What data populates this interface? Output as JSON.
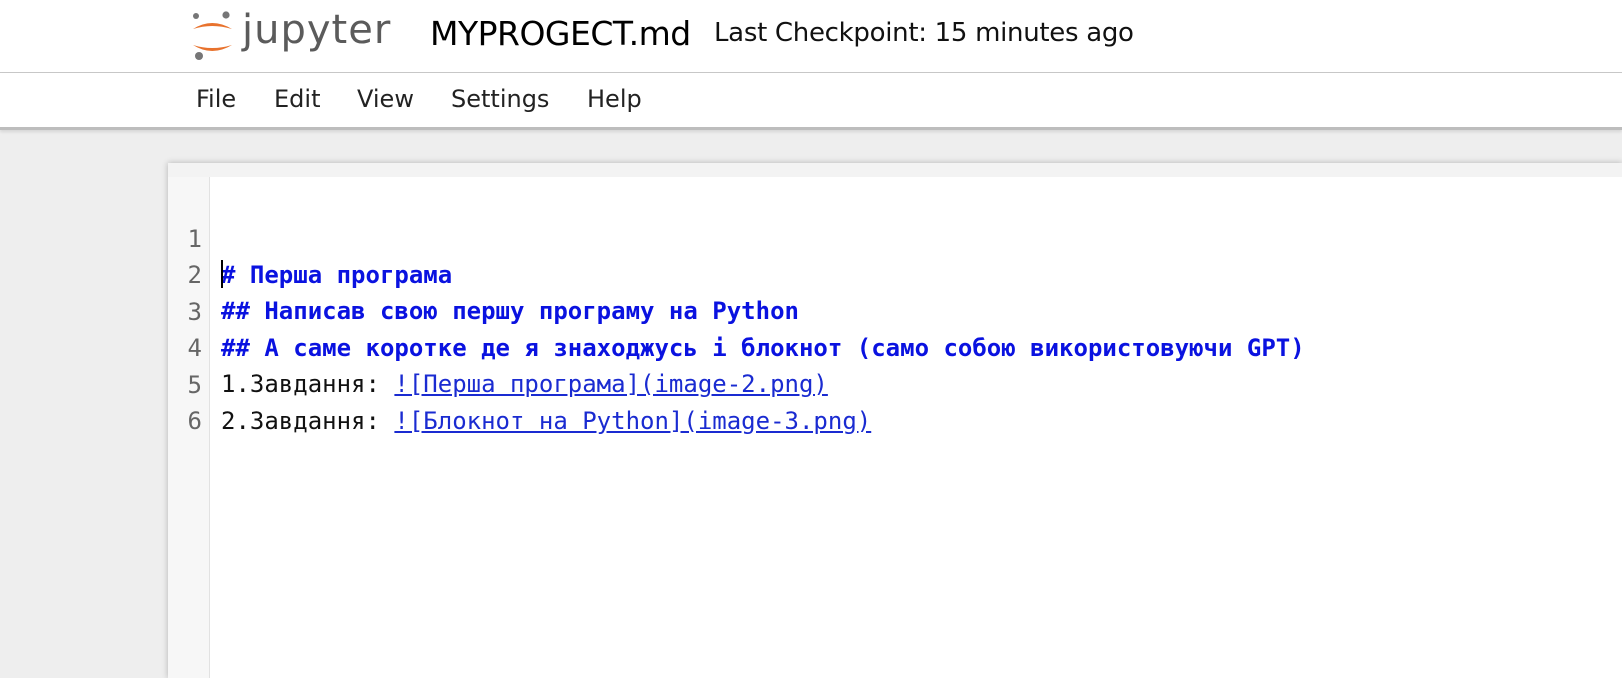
{
  "header": {
    "logo_text": "jupyter",
    "document_title": "MYPROGECT.md",
    "checkpoint": "Last Checkpoint: 15 minutes ago"
  },
  "menu": {
    "file": "File",
    "edit": "Edit",
    "view": "View",
    "settings": "Settings",
    "help": "Help"
  },
  "editor": {
    "line_numbers": [
      "1",
      "2",
      "3",
      "4",
      "5",
      "6"
    ],
    "line1": "# Перша програма",
    "line2": "## Написав свою першу програму на Python",
    "line3": "## А саме коротке де я знаходжусь і блокнот (само собою використовуючи GPT)",
    "line4_prefix": "1.Завдання: ",
    "line4_link": "![Перша програма](image-2.png)",
    "line5_prefix": "2.Завдання: ",
    "line5_link": "![Блокнот на Python](image-3.png)",
    "line6": ""
  },
  "icons": {
    "logo": "jupyter-logo-icon"
  },
  "colors": {
    "heading": "#0a12e0",
    "link": "#1a2bd1",
    "logo_orange": "#e8722d",
    "logo_gray": "#767677"
  }
}
